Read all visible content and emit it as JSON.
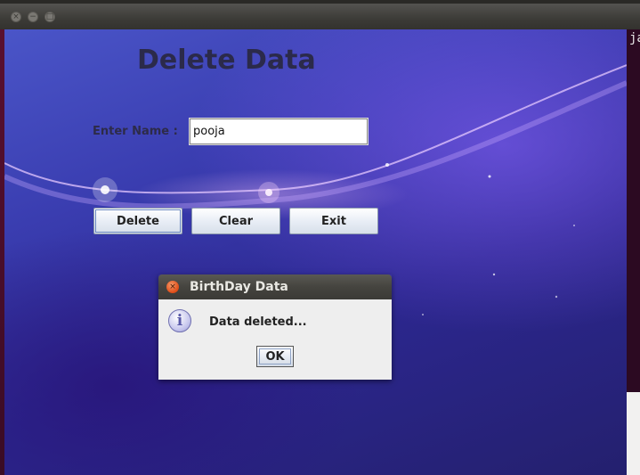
{
  "window": {
    "buttons": [
      "close",
      "minimize",
      "maximize"
    ]
  },
  "terminal": {
    "visible_text": "ja"
  },
  "form": {
    "heading": "Delete Data",
    "name_label": "Enter Name :",
    "name_value": "pooja",
    "buttons": {
      "delete": "Delete",
      "clear": "Clear",
      "exit": "Exit"
    }
  },
  "dialog": {
    "title": "BirthDay Data",
    "message": "Data deleted...",
    "ok_label": "OK",
    "icon": "info-icon"
  },
  "colors": {
    "background_accent": "#3a3db0",
    "dialog_close": "#df4b16",
    "titlebar": "#3c3b37"
  }
}
